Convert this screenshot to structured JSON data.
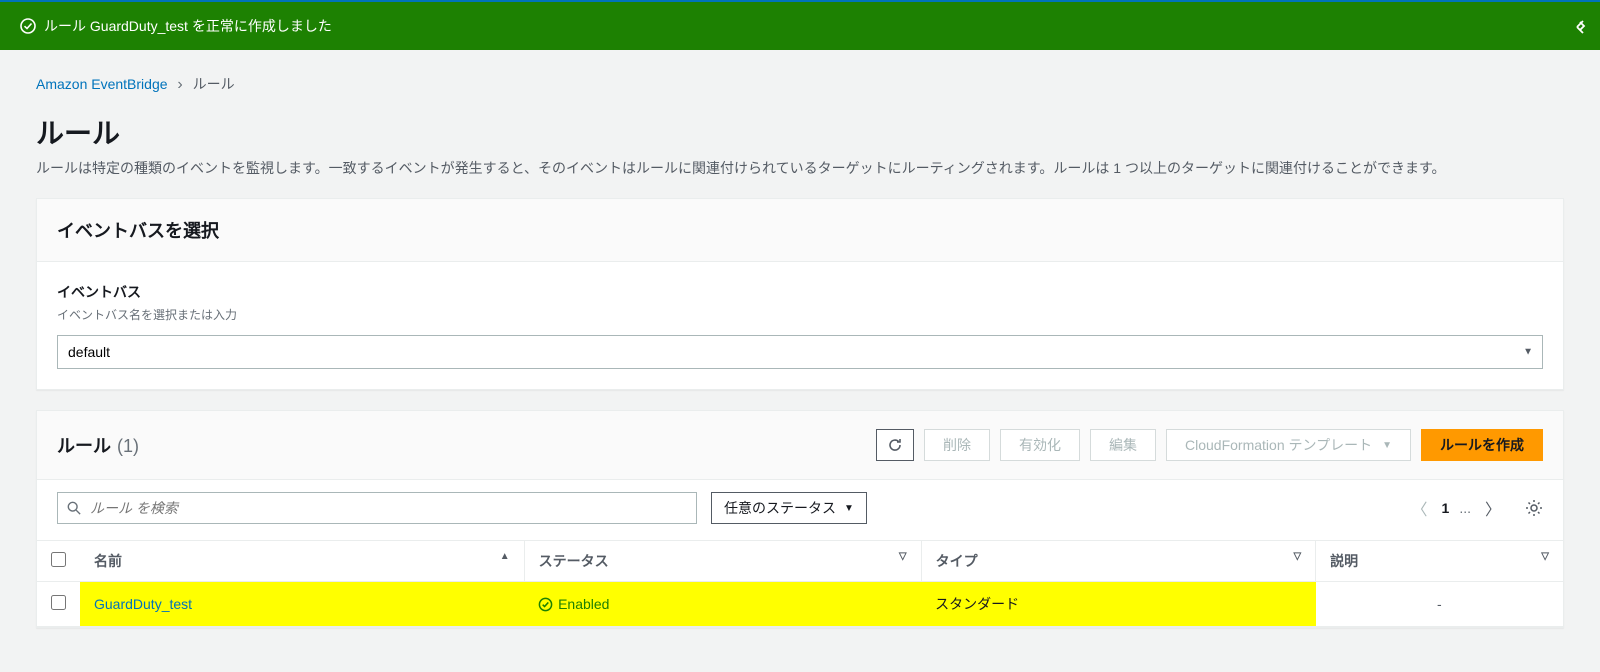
{
  "flash": {
    "message": "ルール GuardDuty_test を正常に作成しました"
  },
  "breadcrumb": {
    "service": "Amazon EventBridge",
    "current": "ルール"
  },
  "header": {
    "title": "ルール",
    "description": "ルールは特定の種類のイベントを監視します。一致するイベントが発生すると、そのイベントはルールに関連付けられているターゲットにルーティングされます。ルールは 1 つ以上のターゲットに関連付けることができます。"
  },
  "event_bus_panel": {
    "title": "イベントバスを選択",
    "field_label": "イベントバス",
    "field_hint": "イベントバス名を選択または入力",
    "value": "default"
  },
  "rules_panel": {
    "title": "ルール",
    "count": "(1)",
    "buttons": {
      "delete": "削除",
      "enable": "有効化",
      "edit": "編集",
      "cloudformation": "CloudFormation テンプレート",
      "create": "ルールを作成"
    },
    "search_placeholder": "ルール を検索",
    "status_filter": "任意のステータス",
    "pager": {
      "page": "1",
      "ellipsis": "..."
    },
    "columns": {
      "name": "名前",
      "status": "ステータス",
      "type": "タイプ",
      "description": "説明"
    },
    "rows": [
      {
        "name": "GuardDuty_test",
        "status": "Enabled",
        "type": "スタンダード",
        "description": "-"
      }
    ]
  }
}
